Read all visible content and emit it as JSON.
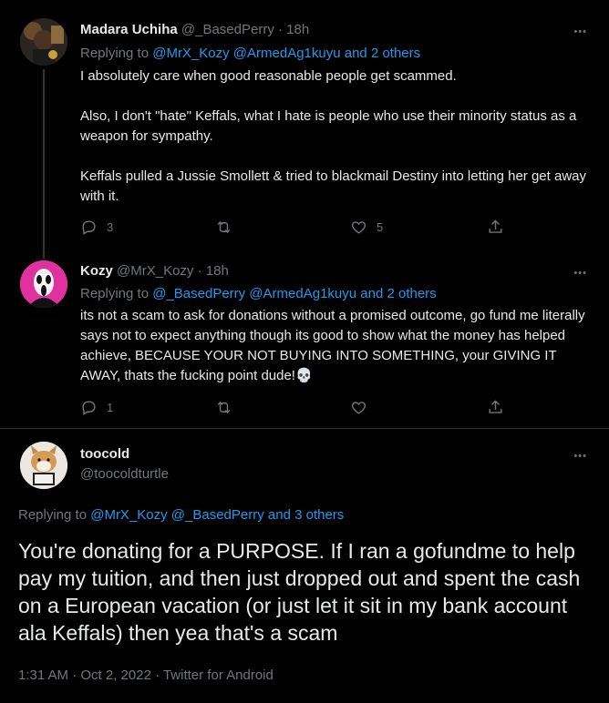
{
  "tweets": [
    {
      "name": "Madara Uchiha",
      "handle": "@_BasedPerry",
      "time": "· 18h",
      "replying_prefix": "Replying to",
      "replying_to": "@MrX_Kozy @ArmedAg1kuyu and 2 others",
      "paragraphs": [
        "I absolutely care when good reasonable people get scammed.",
        "Also, I don't \"hate\" Keffals, what I hate is people who use their minority status as a weapon for sympathy.",
        "Keffals pulled a Jussie Smollett & tried to blackmail Destiny into letting her get away with it."
      ],
      "reply_count": "3",
      "retweet_count": "",
      "like_count": "5"
    },
    {
      "name": "Kozy",
      "handle": "@MrX_Kozy",
      "time": "· 18h",
      "replying_prefix": "Replying to",
      "replying_to": "@_BasedPerry @ArmedAg1kuyu and 2 others",
      "text": "its not a scam to ask for donations without a promised outcome, go fund me literally says not to expect anything though its good to show what the money has helped achieve, BECAUSE YOUR NOT BUYING INTO SOMETHING, your GIVING IT AWAY, thats the fucking point dude!💀",
      "reply_count": "1",
      "retweet_count": "",
      "like_count": ""
    }
  ],
  "main_tweet": {
    "name": "toocold",
    "handle": "@toocoldturtle",
    "replying_prefix": "Replying to",
    "replying_to": "@MrX_Kozy @_BasedPerry and 3 others",
    "text": "You're donating for a PURPOSE. If I ran a gofundme to help pay my tuition, and then just dropped out and spent the cash on a European vacation (or just let it sit in my bank account ala Keffals) then yea that's a scam",
    "meta": "1:31 AM · Oct 2, 2022 · Twitter for Android"
  },
  "more_glyph": "•••",
  "icons": [
    "reply-icon",
    "retweet-icon",
    "like-icon",
    "share-icon",
    "more-icon"
  ]
}
